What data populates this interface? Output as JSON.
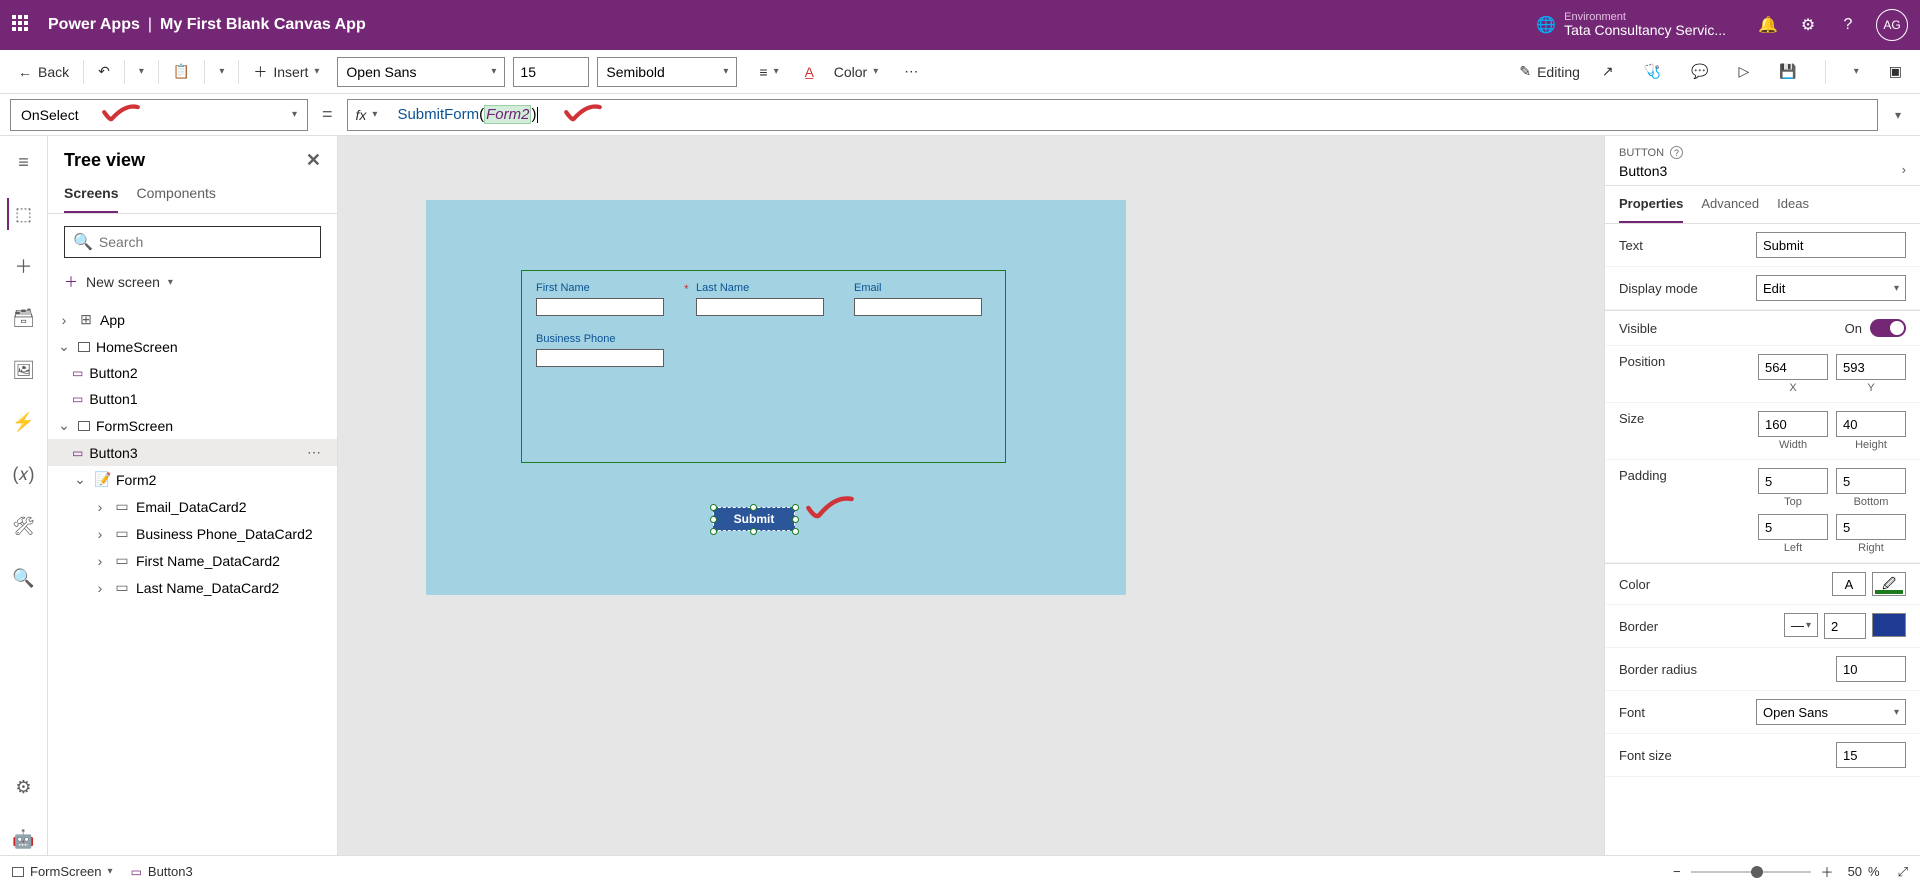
{
  "header": {
    "product": "Power Apps",
    "separator": "|",
    "appName": "My First Blank Canvas App",
    "envLabel": "Environment",
    "envName": "Tata Consultancy Servic...",
    "avatar": "AG"
  },
  "toolbar": {
    "back": "Back",
    "insert": "Insert",
    "font": "Open Sans",
    "fontSize": "15",
    "fontWeight": "Semibold",
    "colorLabel": "Color",
    "modeLabel": "Editing"
  },
  "formula": {
    "property": "OnSelect",
    "func": "SubmitForm",
    "arg": "Form2"
  },
  "tree": {
    "title": "Tree view",
    "tabScreens": "Screens",
    "tabComponents": "Components",
    "searchPlaceholder": "Search",
    "newScreen": "New screen",
    "app": "App",
    "homeScreen": "HomeScreen",
    "button2": "Button2",
    "button1": "Button1",
    "formScreen": "FormScreen",
    "button3": "Button3",
    "form2": "Form2",
    "emailDC": "Email_DataCard2",
    "phoneDC": "Business Phone_DataCard2",
    "fnameDC": "First Name_DataCard2",
    "lnameDC": "Last Name_DataCard2"
  },
  "canvas": {
    "firstName": "First Name",
    "lastName": "Last Name",
    "email": "Email",
    "businessPhone": "Business Phone",
    "submit": "Submit"
  },
  "props": {
    "type": "BUTTON",
    "name": "Button3",
    "tabProps": "Properties",
    "tabAdv": "Advanced",
    "tabIdeas": "Ideas",
    "textLabel": "Text",
    "textVal": "Submit",
    "displayModeLabel": "Display mode",
    "displayModeVal": "Edit",
    "visibleLabel": "Visible",
    "visibleVal": "On",
    "positionLabel": "Position",
    "posX": "564",
    "posY": "593",
    "xLabel": "X",
    "yLabel": "Y",
    "sizeLabel": "Size",
    "width": "160",
    "height": "40",
    "widthLabel": "Width",
    "heightLabel": "Height",
    "paddingLabel": "Padding",
    "padTop": "5",
    "padBottom": "5",
    "padLeft": "5",
    "padRight": "5",
    "topLabel": "Top",
    "bottomLabel": "Bottom",
    "leftLabel": "Left",
    "rightLabel": "Right",
    "colorLabel": "Color",
    "borderLabel": "Border",
    "borderWidth": "2",
    "borderRadiusLabel": "Border radius",
    "borderRadius": "10",
    "fontLabel": "Font",
    "fontVal": "Open Sans",
    "fontSizeLabel": "Font size",
    "fontSizeVal": "15"
  },
  "status": {
    "screen": "FormScreen",
    "selected": "Button3",
    "zoom": "50",
    "zoomSuffix": "%"
  }
}
